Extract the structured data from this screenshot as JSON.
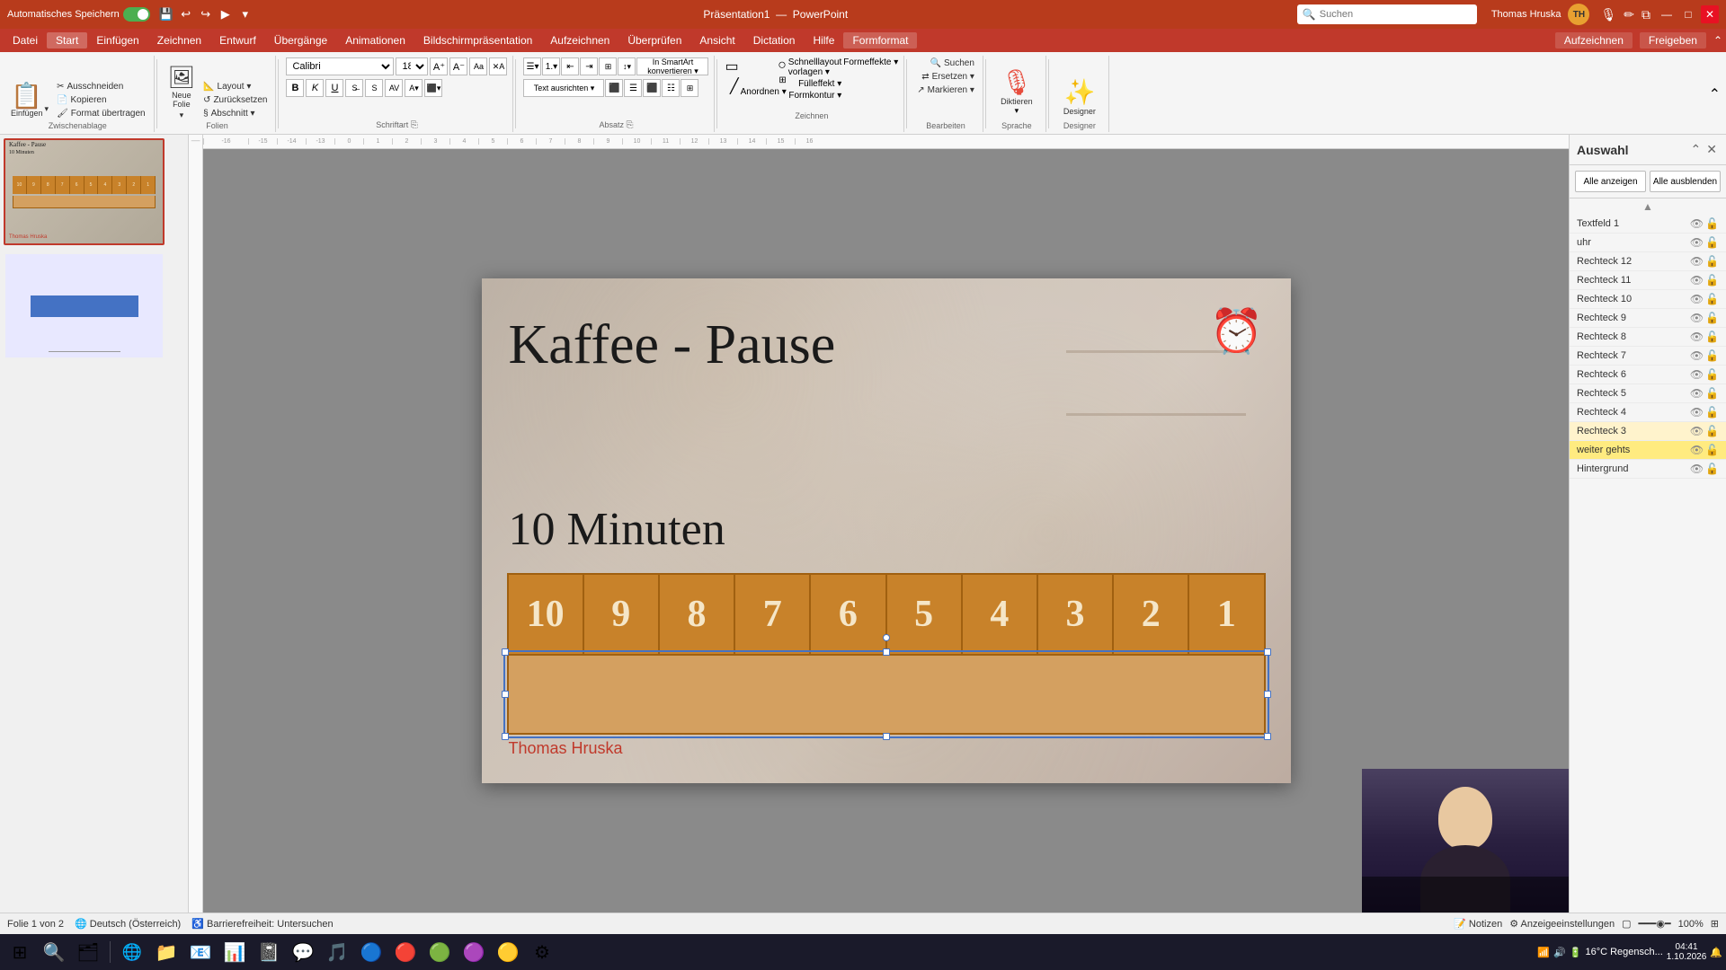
{
  "titlebar": {
    "autosave_label": "Automatisches Speichern",
    "autosave_on": true,
    "filename": "Präsentation1",
    "app": "PowerPoint",
    "search_placeholder": "Suchen",
    "user": "Thomas Hruska",
    "user_initials": "TH",
    "minimize": "—",
    "maximize": "□",
    "close": "✕"
  },
  "menubar": {
    "items": [
      {
        "label": "Datei",
        "id": "datei"
      },
      {
        "label": "Start",
        "id": "start",
        "active": true
      },
      {
        "label": "Einfügen",
        "id": "einfuegen"
      },
      {
        "label": "Zeichnen",
        "id": "zeichnen"
      },
      {
        "label": "Entwurf",
        "id": "entwurf"
      },
      {
        "label": "Übergänge",
        "id": "uebergaenge"
      },
      {
        "label": "Animationen",
        "id": "animationen"
      },
      {
        "label": "Bildschirmpräsentation",
        "id": "bildschirm"
      },
      {
        "label": "Aufzeichnen",
        "id": "aufzeichnen"
      },
      {
        "label": "Überprüfen",
        "id": "ueberpruefen"
      },
      {
        "label": "Ansicht",
        "id": "ansicht"
      },
      {
        "label": "Dictation",
        "id": "dictation"
      },
      {
        "label": "Hilfe",
        "id": "hilfe"
      },
      {
        "label": "Formformat",
        "id": "formformat",
        "highlight": true
      }
    ]
  },
  "ribbon": {
    "groups": [
      {
        "label": "Zwischenablage",
        "buttons": [
          {
            "icon": "📋",
            "label": "Einfügen"
          },
          {
            "icon": "✂",
            "label": "Ausschneiden"
          },
          {
            "icon": "📄",
            "label": "Kopieren"
          },
          {
            "icon": "🖌",
            "label": "Format übertragen"
          }
        ]
      },
      {
        "label": "Folien",
        "buttons": [
          {
            "icon": "🖼",
            "label": "Neue Folie"
          },
          {
            "icon": "📐",
            "label": "Layout"
          },
          {
            "icon": "↺",
            "label": "Zurücksetzen"
          },
          {
            "icon": "§",
            "label": "Abschnitt"
          }
        ]
      },
      {
        "label": "Schriftart",
        "font_name": "Calibri",
        "font_size": "18"
      },
      {
        "label": "Absatz"
      },
      {
        "label": "Zeichnen"
      },
      {
        "label": "Bearbeiten",
        "buttons": [
          {
            "icon": "🔍",
            "label": "Suchen"
          },
          {
            "icon": "↔",
            "label": "Ersetzen"
          },
          {
            "icon": "☰",
            "label": "Markieren"
          }
        ]
      },
      {
        "label": "Sprache",
        "buttons": [
          {
            "icon": "🎙",
            "label": "Diktieren"
          },
          {
            "label": "Diktieren"
          }
        ]
      },
      {
        "label": "Designer",
        "buttons": [
          {
            "icon": "✨",
            "label": "Designer"
          }
        ]
      }
    ],
    "right_buttons": [
      {
        "label": "Aufzeichnen"
      },
      {
        "label": "Freigeben"
      }
    ]
  },
  "slide_panel": {
    "slides": [
      {
        "number": 1,
        "title": "Kaffee - Pause",
        "subtitle": "10 Minuten",
        "active": true
      },
      {
        "number": 2,
        "active": false
      }
    ]
  },
  "slide": {
    "title": "Kaffee - Pause",
    "subtitle": "10 Minuten",
    "author": "Thomas Hruska",
    "timer_numbers": [
      "10",
      "9",
      "8",
      "7",
      "6",
      "5",
      "4",
      "3",
      "2",
      "1"
    ]
  },
  "right_panel": {
    "title": "Auswahl",
    "btn_show_all": "Alle anzeigen",
    "btn_hide_all": "Alle ausblenden",
    "layers": [
      {
        "name": "Textfeld 1",
        "visible": true,
        "locked": false
      },
      {
        "name": "uhr",
        "visible": true,
        "locked": false
      },
      {
        "name": "Rechteck 12",
        "visible": true,
        "locked": false
      },
      {
        "name": "Rechteck 11",
        "visible": true,
        "locked": false
      },
      {
        "name": "Rechteck 10",
        "visible": true,
        "locked": false
      },
      {
        "name": "Rechteck 9",
        "visible": true,
        "locked": false
      },
      {
        "name": "Rechteck 8",
        "visible": true,
        "locked": false
      },
      {
        "name": "Rechteck 7",
        "visible": true,
        "locked": false
      },
      {
        "name": "Rechteck 6",
        "visible": true,
        "locked": false
      },
      {
        "name": "Rechteck 5",
        "visible": true,
        "locked": false
      },
      {
        "name": "Rechteck 4",
        "visible": true,
        "locked": false
      },
      {
        "name": "Rechteck 3",
        "visible": true,
        "locked": false,
        "selected": true
      },
      {
        "name": "weiter gehts",
        "visible": true,
        "locked": false,
        "highlighted": true
      },
      {
        "name": "Hintergrund",
        "visible": true,
        "locked": false
      }
    ]
  },
  "status_bar": {
    "slide_info": "Folie 1 von 2",
    "language": "Deutsch (Österreich)",
    "accessibility": "Barrierefreiheit: Untersuchen",
    "notes_btn": "Notizen",
    "settings_btn": "Anzeigeeinstellungen"
  },
  "taskbar": {
    "weather": "16°C  Regensch...",
    "icons": [
      "⊞",
      "🔍",
      "🗂",
      "🌐",
      "📧",
      "🎨",
      "📊",
      "🎵",
      "📱",
      "🎙",
      "📁",
      "🎮",
      "🌍",
      "💬",
      "🎯",
      "🖥"
    ]
  }
}
